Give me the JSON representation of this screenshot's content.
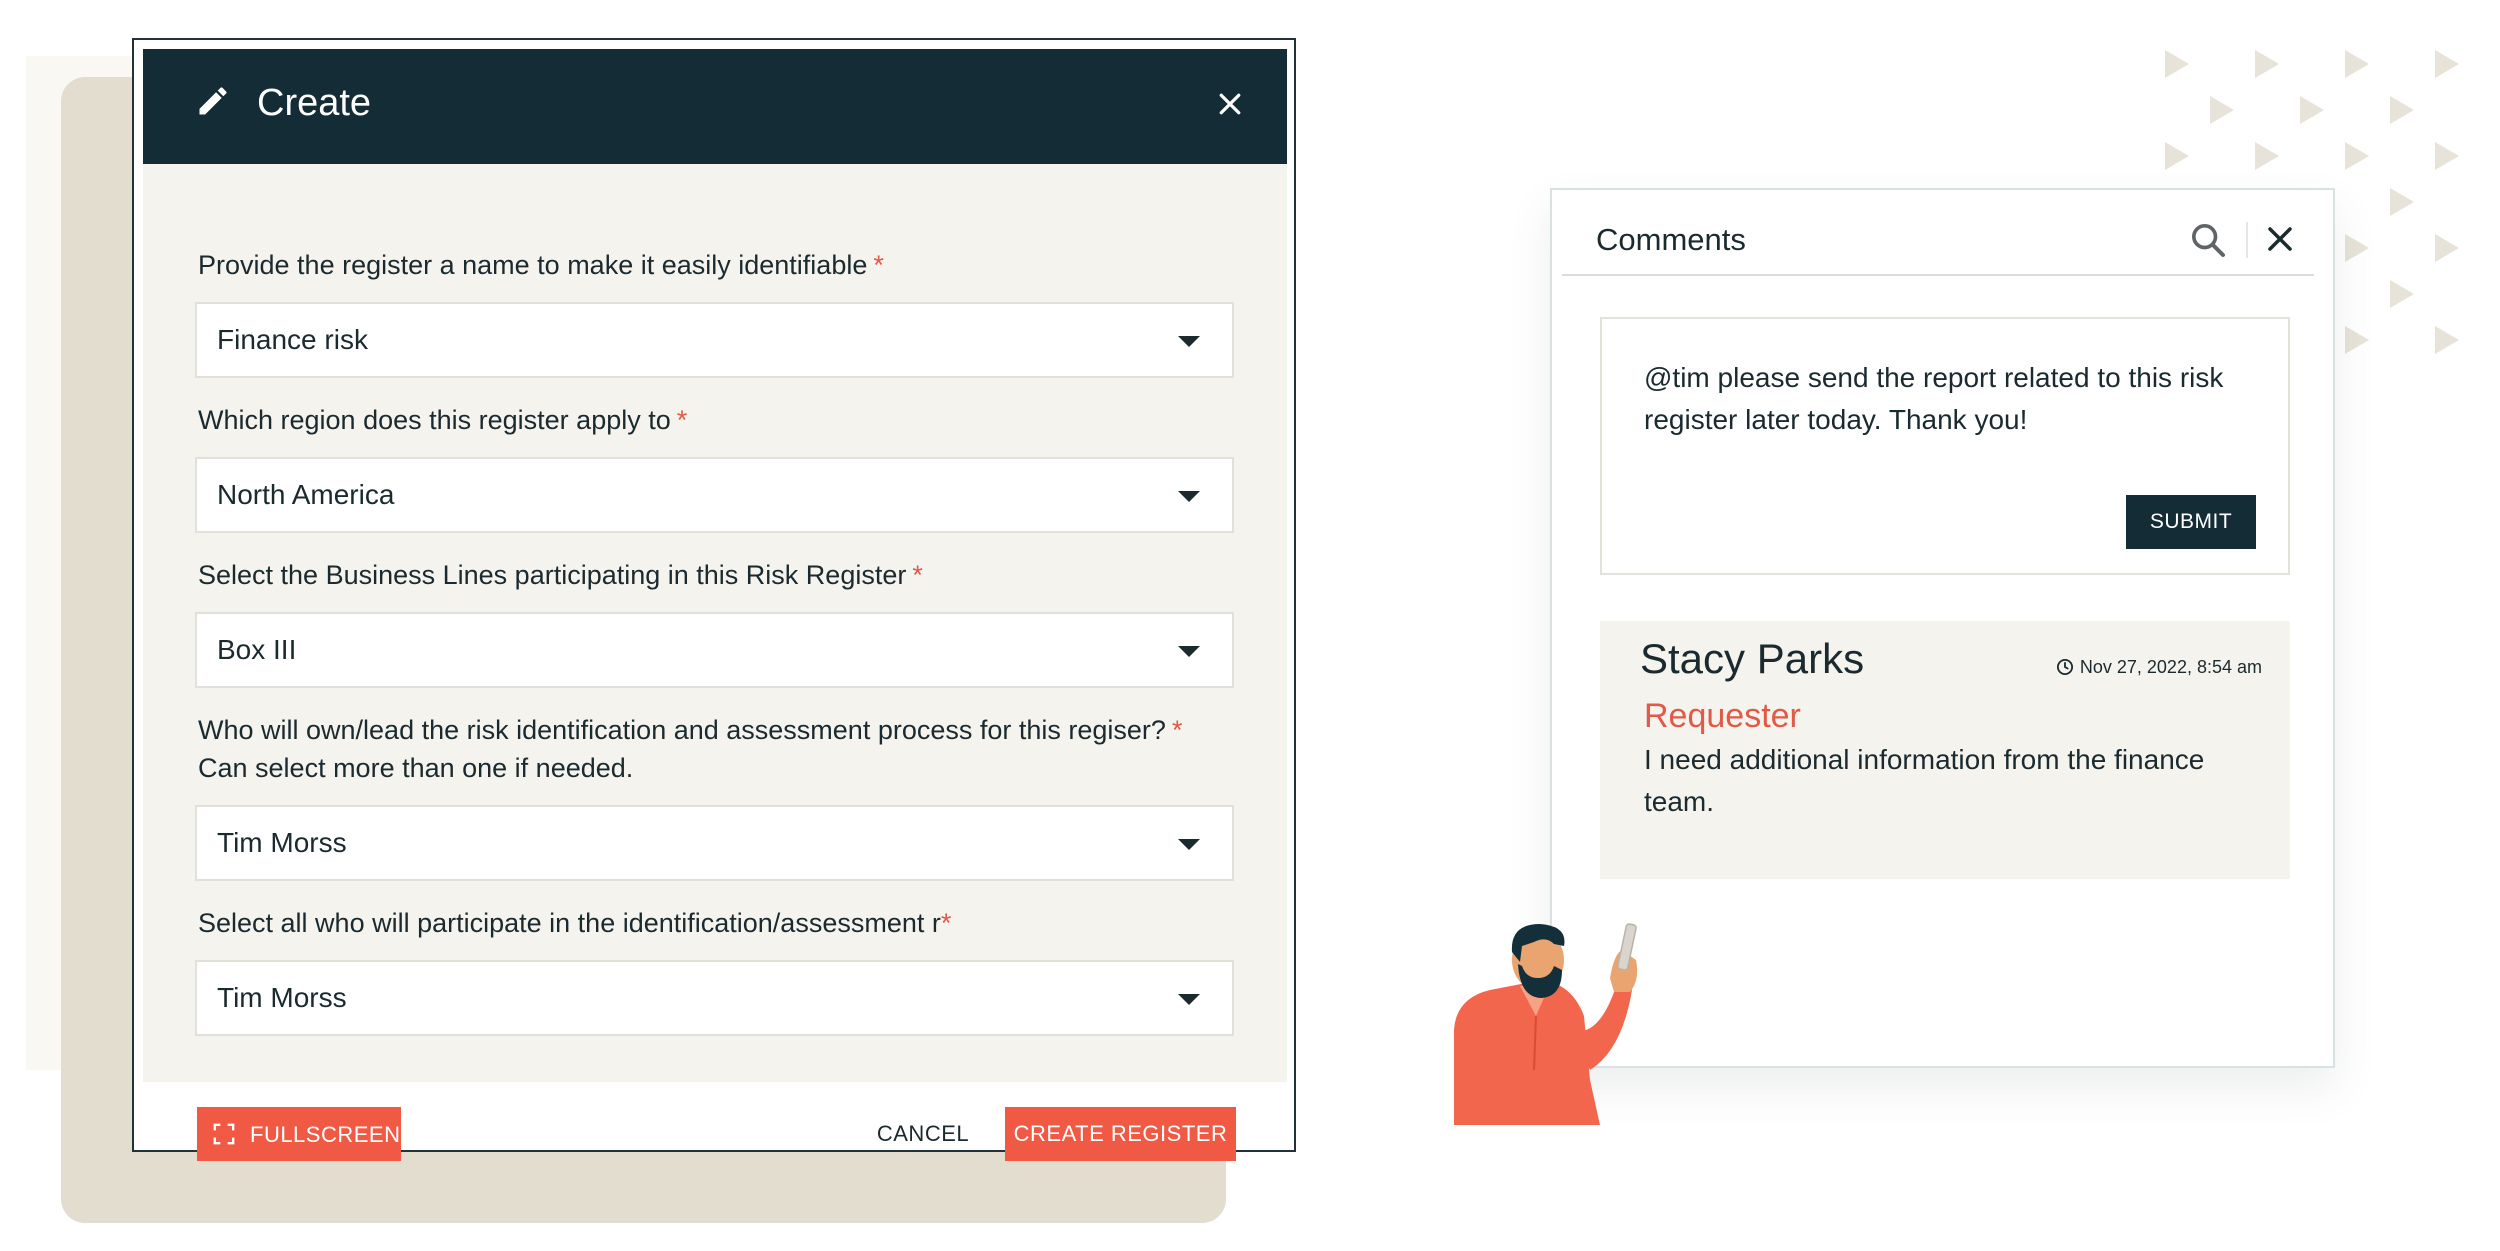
{
  "dialog": {
    "title": "Create",
    "fields": [
      {
        "label": "Provide the register a name to make it easily identifiable",
        "required_mark": "*",
        "value": "Finance risk"
      },
      {
        "label": "Which region does this register apply to",
        "required_mark": "*",
        "value": "North America"
      },
      {
        "label": "Select the Business Lines participating in this Risk Register",
        "required_mark": "*",
        "value": "Box III"
      },
      {
        "label": "Who will own/lead the risk identification and assessment process for this regiser?",
        "required_mark": "*",
        "hint": "Can select more than one if needed.",
        "value": "Tim Morss"
      },
      {
        "label": "Select all who will participate in the identification/assessment r",
        "required_mark": "*",
        "value": "Tim Morss"
      }
    ],
    "footer": {
      "fullscreen_label": "FULLSCREEN",
      "cancel_label": "CANCEL",
      "create_label": "CREATE REGISTER"
    }
  },
  "comments": {
    "title": "Comments",
    "draft_text": "@tim please send the report related to this risk register later today. Thank you!",
    "submit_label": "SUBMIT",
    "items": [
      {
        "author": "Stacy Parks",
        "timestamp": "Nov 27, 2022, 8:54 am",
        "role": "Requester",
        "text": "I need additional information from the finance team."
      }
    ]
  },
  "colors": {
    "header_dark": "#142c36",
    "accent_red": "#f05a45",
    "body_bg": "#f5f3ee",
    "backdrop_beige": "#e3ddd0"
  }
}
